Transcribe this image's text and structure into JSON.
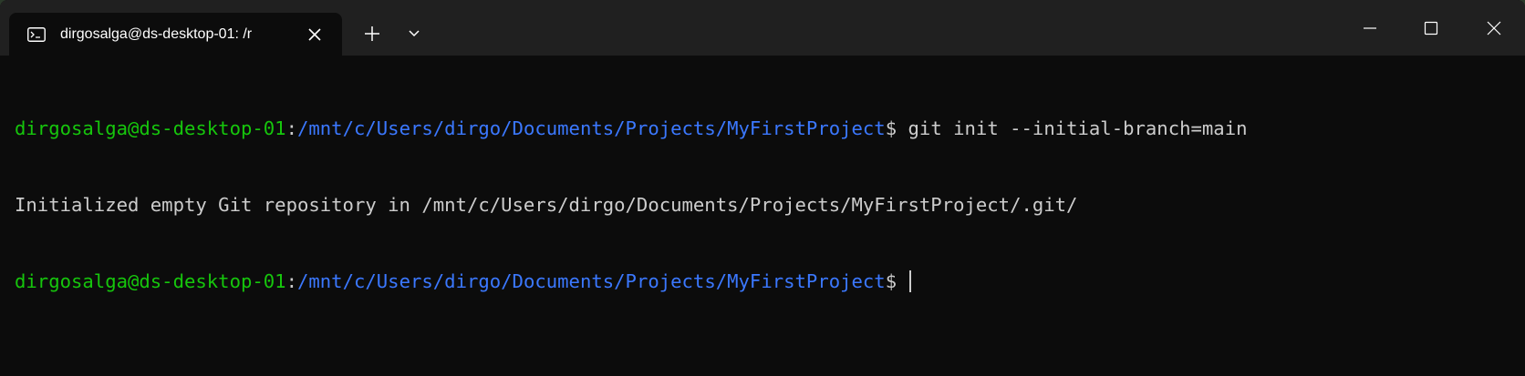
{
  "tab": {
    "title": "dirgosalga@ds-desktop-01: /r",
    "icon": "terminal-icon"
  },
  "titlebar": {
    "new_tab_icon": "plus-icon",
    "dropdown_icon": "chevron-down-icon",
    "minimize_icon": "minimize-icon",
    "maximize_icon": "maximize-icon",
    "close_icon": "close-icon"
  },
  "terminal": {
    "lines": [
      {
        "user": "dirgosalga@ds-desktop-01",
        "sep": ":",
        "path": "/mnt/c/Users/dirgo/Documents/Projects/MyFirstProject",
        "symbol": "$ ",
        "command": "git init --initial-branch=main"
      },
      {
        "output": "Initialized empty Git repository in /mnt/c/Users/dirgo/Documents/Projects/MyFirstProject/.git/"
      },
      {
        "user": "dirgosalga@ds-desktop-01",
        "sep": ":",
        "path": "/mnt/c/Users/dirgo/Documents/Projects/MyFirstProject",
        "symbol": "$ ",
        "command": ""
      }
    ]
  },
  "colors": {
    "background": "#0c0c0c",
    "titlebar": "#202020",
    "prompt_user": "#16c60c",
    "prompt_path": "#3b78ff",
    "text": "#cccccc"
  }
}
